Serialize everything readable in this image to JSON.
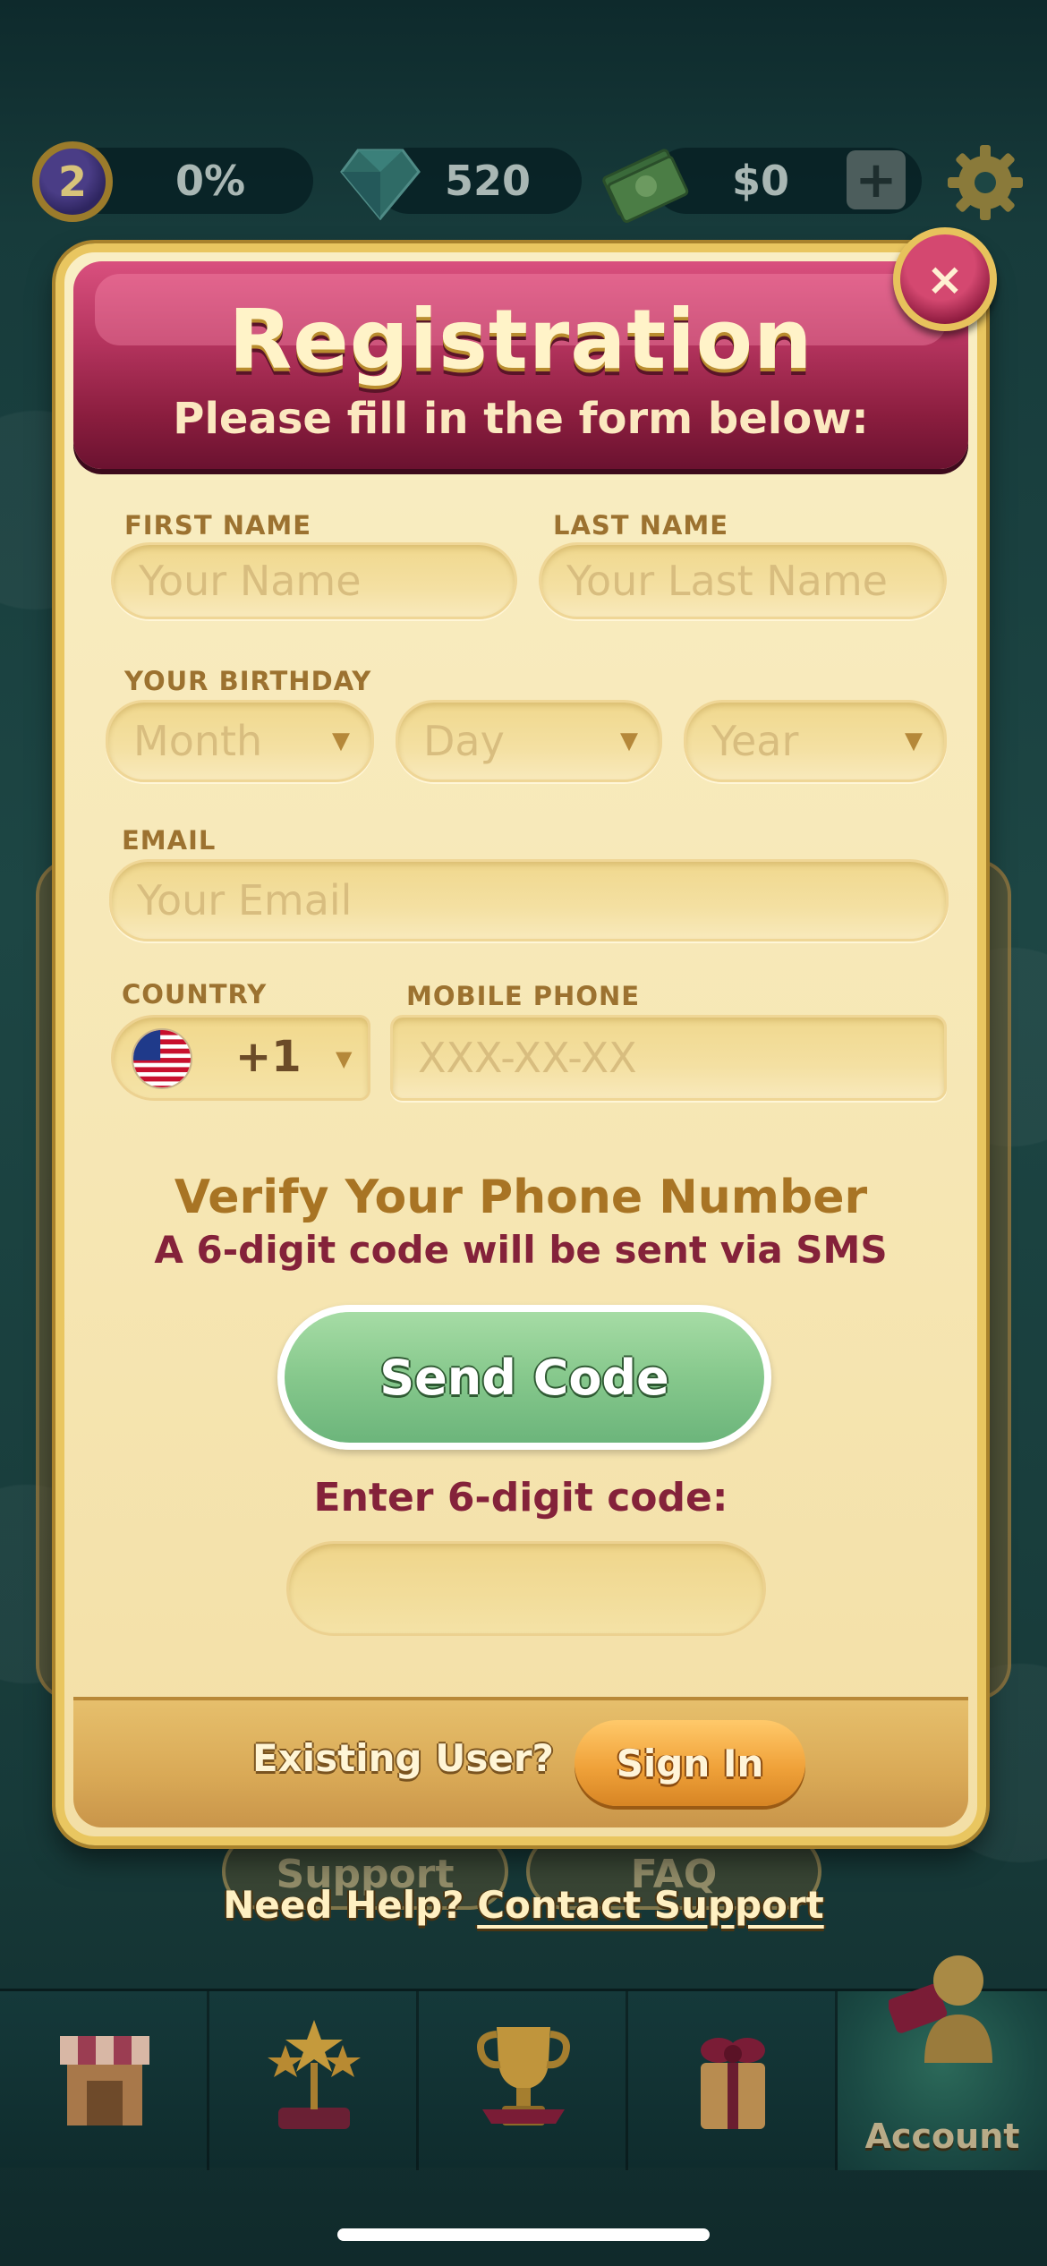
{
  "topbar": {
    "level": "2",
    "progress": "0%",
    "gems": "520",
    "cash": "$0",
    "plus": "+"
  },
  "modal": {
    "title": "Registration",
    "subtitle": "Please fill in the form below:",
    "close": "×",
    "first_name": {
      "label": "FIRST NAME",
      "placeholder": "Your Name"
    },
    "last_name": {
      "label": "LAST NAME",
      "placeholder": "Your Last Name"
    },
    "birthday": {
      "label": "YOUR BIRTHDAY",
      "month": "Month",
      "day": "Day",
      "year": "Year"
    },
    "email": {
      "label": "EMAIL",
      "placeholder": "Your Email"
    },
    "country": {
      "label": "COUNTRY",
      "dial_code": "+1"
    },
    "mobile": {
      "label": "MOBILE PHONE",
      "placeholder": "XXX-XX-XX"
    },
    "verify": {
      "title": "Verify Your Phone Number",
      "subtitle": "A 6-digit code will be sent via SMS",
      "send_button": "Send Code",
      "code_label": "Enter 6-digit code:"
    },
    "footer": {
      "existing_user": "Existing User?",
      "sign_in": "Sign In"
    }
  },
  "background": {
    "support": "Support",
    "faq": "FAQ",
    "need_help": "Need Help?",
    "contact_support": "Contact Support"
  },
  "bottom_nav": {
    "tabs": [
      {
        "icon": "shop-icon",
        "label": ""
      },
      {
        "icon": "stars-icon",
        "label": ""
      },
      {
        "icon": "trophy-icon",
        "label": ""
      },
      {
        "icon": "gift-icon",
        "label": ""
      },
      {
        "icon": "account-icon",
        "label": "Account"
      }
    ]
  },
  "colors": {
    "header_pink": "#b3335d",
    "cream": "#f8ecc2",
    "label_gold": "#9c7230",
    "send_green": "#86c88c",
    "signin_orange": "#f0a23a",
    "maroon_text": "#84223a"
  }
}
